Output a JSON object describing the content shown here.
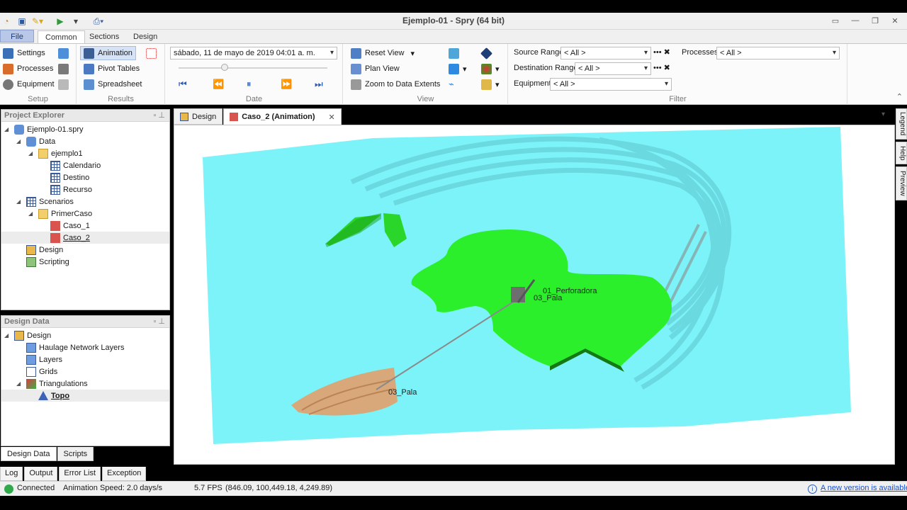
{
  "window": {
    "title": "Ejemplo-01 - Spry (64 bit)"
  },
  "ribbon_tabs": [
    "File",
    "Common",
    "Sections",
    "Design"
  ],
  "ribbon": {
    "setup": {
      "label": "Setup",
      "settings": "Settings",
      "processes": "Processes",
      "equipment": "Equipment"
    },
    "results": {
      "label": "Results",
      "animation": "Animation",
      "pivot_tables": "Pivot Tables",
      "spreadsheet": "Spreadsheet"
    },
    "date": {
      "label": "Date",
      "value": "sábado, 11 de mayo de 2019 04:01 a. m."
    },
    "view": {
      "label": "View",
      "reset_view": "Reset View",
      "plan_view": "Plan View",
      "zoom_extents": "Zoom to Data Extents"
    },
    "filter": {
      "label": "Filter",
      "source_range": "Source Range",
      "destination_range": "Destination Range",
      "equipment": "Equipment",
      "processes": "Processes",
      "all": "< All >"
    }
  },
  "project_explorer": {
    "title": "Project Explorer",
    "items": [
      {
        "label": "Ejemplo-01.spry"
      },
      {
        "label": "Data"
      },
      {
        "label": "ejemplo1"
      },
      {
        "label": "Calendario"
      },
      {
        "label": "Destino"
      },
      {
        "label": "Recurso"
      },
      {
        "label": "Scenarios"
      },
      {
        "label": "PrimerCaso"
      },
      {
        "label": "Caso_1"
      },
      {
        "label": "Caso_2"
      },
      {
        "label": "Design"
      },
      {
        "label": "Scripting"
      }
    ]
  },
  "design_data": {
    "title": "Design Data",
    "items": [
      {
        "label": "Design"
      },
      {
        "label": "Haulage Network Layers"
      },
      {
        "label": "Layers"
      },
      {
        "label": "Grids"
      },
      {
        "label": "Triangulations"
      },
      {
        "label": "Topo"
      }
    ],
    "tabs": [
      "Design Data",
      "Scripts"
    ]
  },
  "doc_tabs": [
    "Design",
    "Caso_2 (Animation)"
  ],
  "side_tabs": [
    "Legend",
    "Help",
    "Preview"
  ],
  "viewport": {
    "labels": [
      "01_Perforadora",
      "03_Pala",
      "03_Pala"
    ]
  },
  "output_tabs": [
    "Log",
    "Output",
    "Error List",
    "Exception"
  ],
  "status": {
    "connected": "Connected",
    "speed": "Animation Speed: 2.0 days/s",
    "fps": "5.7 FPS",
    "coords": "(846.09, 100,449.18, 4,249.89)",
    "update": "A new version is available"
  }
}
